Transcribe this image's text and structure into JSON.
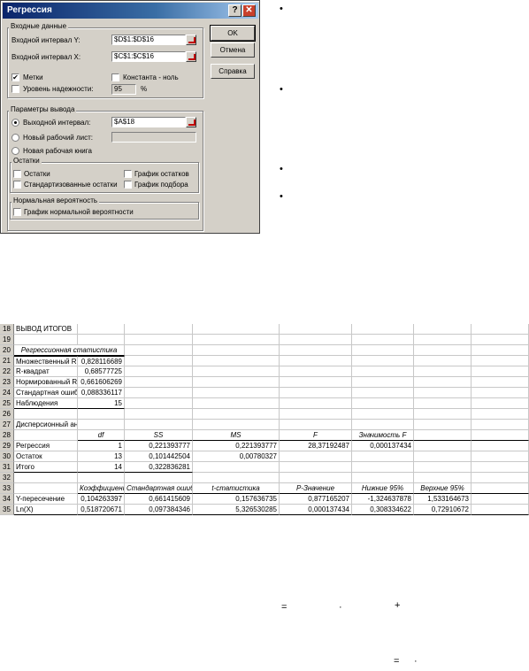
{
  "dialog": {
    "title": "Регрессия",
    "input_group": "Входные данные",
    "input_y_label": "Входной интервал Y:",
    "input_y_value": "$D$1:$D$16",
    "input_x_label": "Входной интервал X:",
    "input_x_value": "$C$1:$C$16",
    "labels_check": "Метки",
    "const_zero_check": "Константа - ноль",
    "confidence_check": "Уровень надежности:",
    "confidence_value": "95",
    "percent": "%",
    "output_group": "Параметры вывода",
    "output_range_label": "Выходной интервал:",
    "output_range_value": "$A$18",
    "new_sheet_label": "Новый рабочий лист:",
    "new_book_label": "Новая рабочая книга",
    "residuals_group": "Остатки",
    "residuals_check": "Остатки",
    "std_residuals_check": "Стандартизованные остатки",
    "residual_plot_check": "График остатков",
    "fit_plot_check": "График подбора",
    "normal_group": "Нормальная вероятность",
    "normal_plot_check": "График нормальной вероятности",
    "ok": "OK",
    "cancel": "Отмена",
    "help": "Справка",
    "help_glyph": "?",
    "close_glyph": "✕",
    "check_mark": "✔"
  },
  "bullets": [
    "•",
    "•",
    "•",
    "•"
  ],
  "sheet": {
    "rows": [
      {
        "n": "18",
        "cells": [
          "ВЫВОД ИТОГОВ",
          "",
          "",
          "",
          "",
          "",
          "",
          ""
        ]
      },
      {
        "n": "19",
        "cells": [
          "",
          "",
          "",
          "",
          "",
          "",
          "",
          ""
        ]
      },
      {
        "n": "20",
        "cells": [
          "Регрессионная статистика",
          "",
          "",
          "",
          "",
          "",
          "",
          ""
        ]
      },
      {
        "n": "21",
        "cells": [
          "Множественный R",
          "0,828116689",
          "",
          "",
          "",
          "",
          "",
          ""
        ]
      },
      {
        "n": "22",
        "cells": [
          "R-квадрат",
          "0,68577725",
          "",
          "",
          "",
          "",
          "",
          ""
        ]
      },
      {
        "n": "23",
        "cells": [
          "Нормированный R-квадрат",
          "0,661606269",
          "",
          "",
          "",
          "",
          "",
          ""
        ]
      },
      {
        "n": "24",
        "cells": [
          "Стандартная ошибка",
          "0,088336117",
          "",
          "",
          "",
          "",
          "",
          ""
        ]
      },
      {
        "n": "25",
        "cells": [
          "Наблюдения",
          "15",
          "",
          "",
          "",
          "",
          "",
          ""
        ]
      },
      {
        "n": "26",
        "cells": [
          "",
          "",
          "",
          "",
          "",
          "",
          "",
          ""
        ]
      },
      {
        "n": "27",
        "cells": [
          "Дисперсионный анализ",
          "",
          "",
          "",
          "",
          "",
          "",
          ""
        ]
      },
      {
        "n": "28",
        "cells": [
          "",
          "df",
          "SS",
          "MS",
          "F",
          "Значимость F",
          "",
          ""
        ]
      },
      {
        "n": "29",
        "cells": [
          "Регрессия",
          "1",
          "0,221393777",
          "0,221393777",
          "28,37192487",
          "0,000137434",
          "",
          ""
        ]
      },
      {
        "n": "30",
        "cells": [
          "Остаток",
          "13",
          "0,101442504",
          "0,00780327",
          "",
          "",
          "",
          ""
        ]
      },
      {
        "n": "31",
        "cells": [
          "Итого",
          "14",
          "0,322836281",
          "",
          "",
          "",
          "",
          ""
        ]
      },
      {
        "n": "32",
        "cells": [
          "",
          "",
          "",
          "",
          "",
          "",
          "",
          ""
        ]
      },
      {
        "n": "33",
        "cells": [
          "",
          "Коэффициенты",
          "Стандартная ошибка",
          "t-статистика",
          "P-Значение",
          "Нижние 95%",
          "Верхние 95%",
          ""
        ]
      },
      {
        "n": "34",
        "cells": [
          "Y-пересечение",
          "0,104263397",
          "0,661415609",
          "0,157636735",
          "0,877165207",
          "-1,324637878",
          "1,533164673",
          ""
        ]
      },
      {
        "n": "35",
        "cells": [
          "Ln(X)",
          "0,518720671",
          "0,097384346",
          "5,326530285",
          "0,000137434",
          "0,308334622",
          "0,72910672",
          ""
        ]
      }
    ]
  },
  "formula": {
    "line1_eq": "=",
    "line1_dot": "·",
    "line1_plus": "+",
    "line2_eq": "=",
    "line2_dot": "·"
  }
}
